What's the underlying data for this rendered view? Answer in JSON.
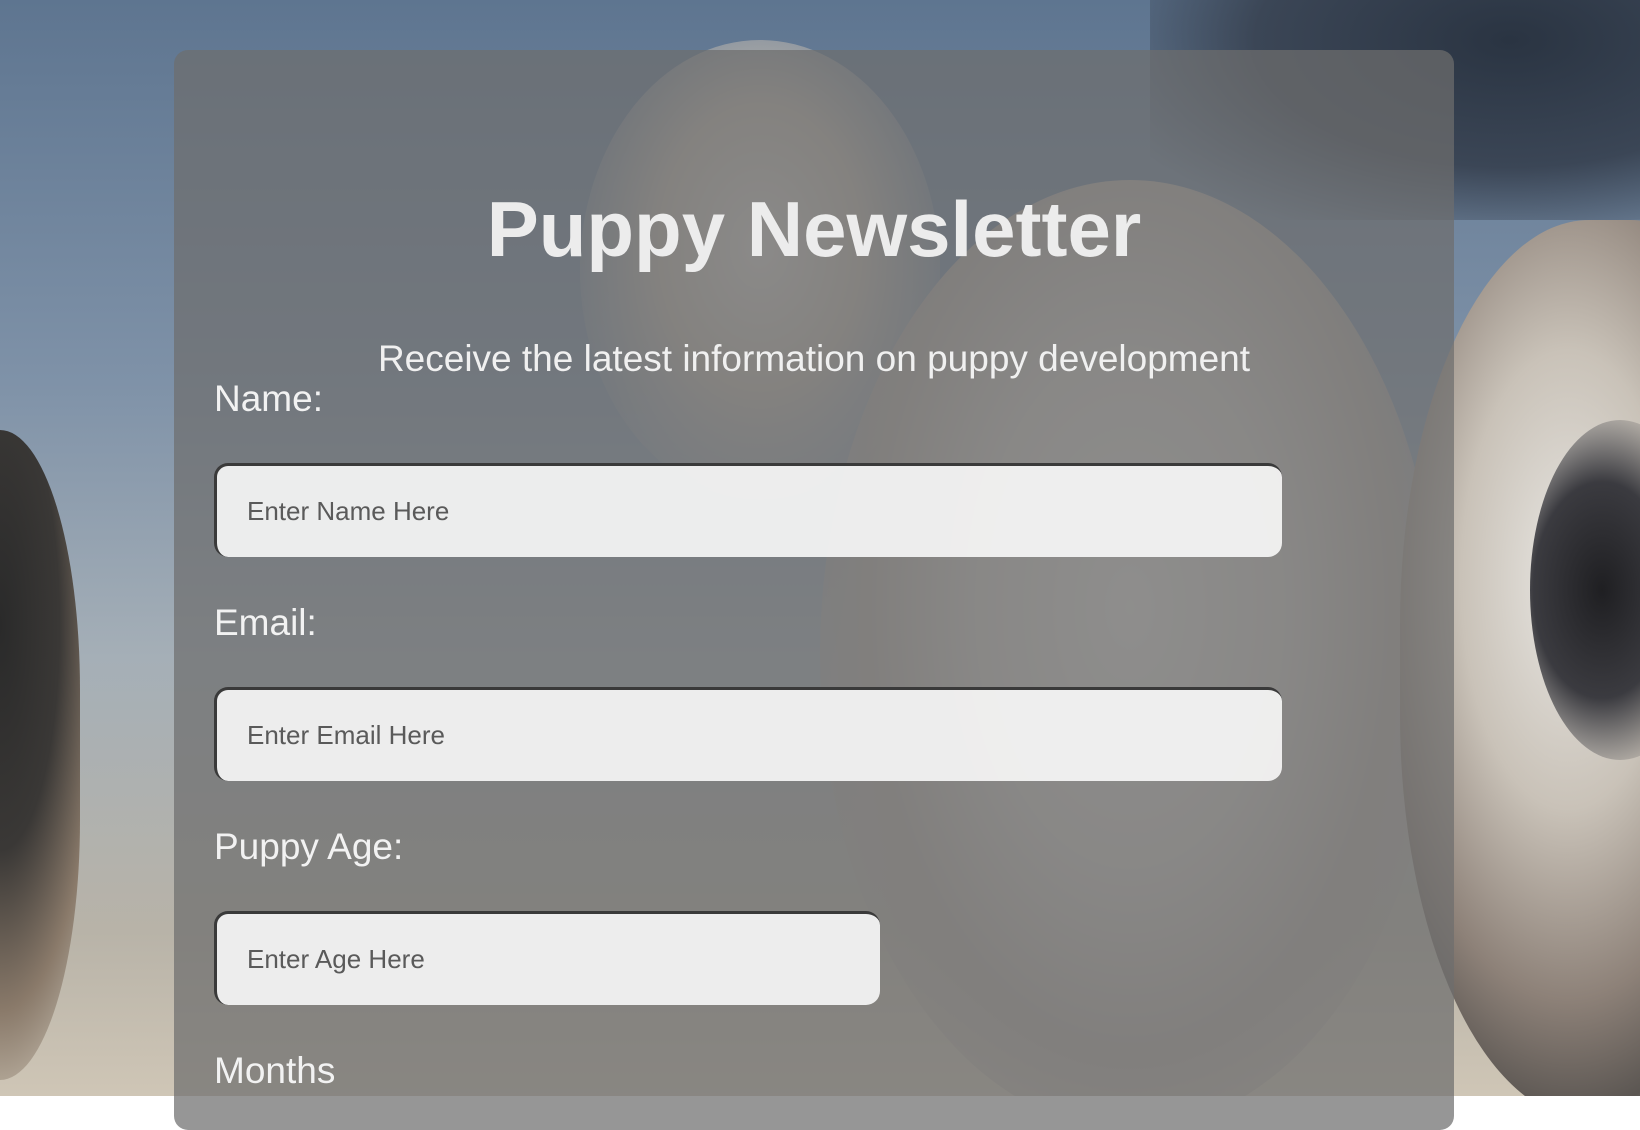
{
  "newsletter": {
    "title": "Puppy Newsletter",
    "subtitle": "Receive the latest information on puppy development"
  },
  "form": {
    "name": {
      "label": "Name:",
      "placeholder": "Enter Name Here",
      "value": ""
    },
    "email": {
      "label": "Email:",
      "placeholder": "Enter Email Here",
      "value": ""
    },
    "age": {
      "label": "Puppy Age:",
      "placeholder": "Enter Age Here",
      "value": "",
      "unit_label": "Months"
    }
  }
}
